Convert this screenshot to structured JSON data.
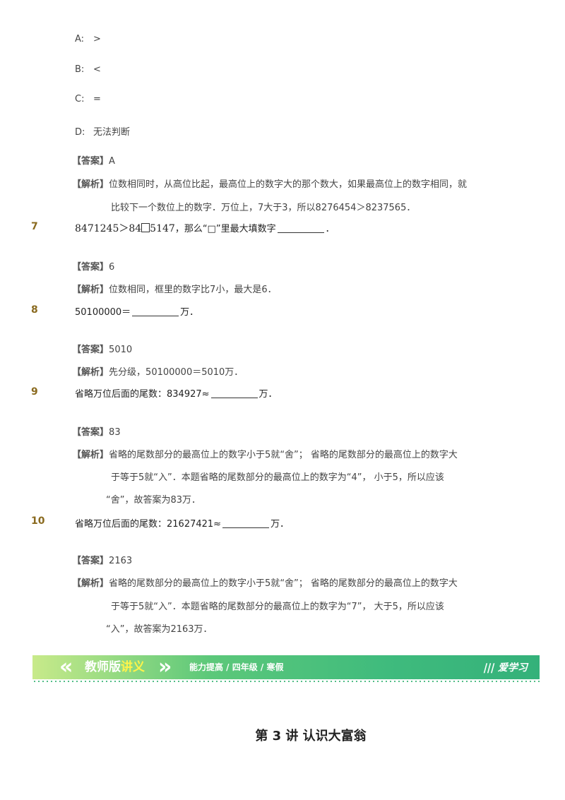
{
  "options": [
    {
      "key": "A:",
      "text": ">"
    },
    {
      "key": "B:",
      "text": "<"
    },
    {
      "key": "C:",
      "text": "="
    },
    {
      "key": "D:",
      "text": "无法判断"
    }
  ],
  "labels": {
    "answer": "答案",
    "analysis": "解析"
  },
  "q6": {
    "answer": "A",
    "analysis": [
      "位数相同时，从高位比起，最高位上的数字大的那个数大，如果最高位上的数字相同，就",
      "比较下一个数位上的数字．万位上，7大于3，所以8276454＞8237565．"
    ]
  },
  "q7": {
    "num": "7",
    "expr_left": "8471245＞84",
    "expr_right": "5147",
    "text": "，那么“□”里最大填数字",
    "end": "．",
    "answer": "6",
    "analysis": [
      "位数相同，框里的数字比7小，最大是6．"
    ]
  },
  "q8": {
    "num": "8",
    "text": "50100000＝",
    "end": "万．",
    "answer": "5010",
    "analysis": [
      "先分级，50100000＝5010万．"
    ]
  },
  "q9": {
    "num": "9",
    "text": "省略万位后面的尾数：834927≈",
    "end": "万．",
    "answer": "83",
    "analysis": [
      "省略的尾数部分的最高位上的数字小于5就“舍”；  省略的尾数部分的最高位上的数字大",
      "于等于5就“入”．本题省略的尾数部分的最高位上的数字为“4”，  小于5，所以应该",
      "“舍”，故答案为83万．"
    ]
  },
  "q10": {
    "num": "10",
    "text": "省略万位后面的尾数：21627421≈",
    "end": "万．",
    "answer": "2163",
    "analysis": [
      "省略的尾数部分的最高位上的数字小于5就“舍”；  省略的尾数部分的最高位上的数字大",
      "于等于5就“入”．本题省略的尾数部分的最高位上的数字为“7”，  大于5，所以应该",
      "“入”，故答案为2163万．"
    ]
  },
  "banner": {
    "title_white": "教师版",
    "title_yellow": "讲义",
    "subtitle": "能力提高 / 四年级 / 寒假",
    "logo_text": "爱学习",
    "logo_icon": "book-stripes-icon"
  },
  "lecture_title": "第 3 讲  认识大富翁"
}
